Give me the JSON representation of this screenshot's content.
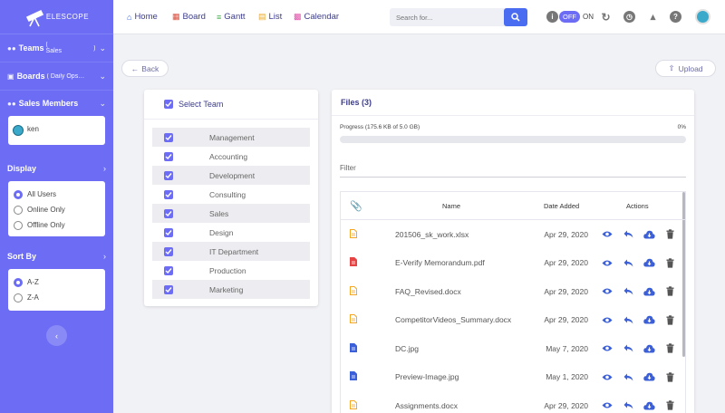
{
  "app": {
    "logo_text": "ELESCOPE"
  },
  "sidebar": {
    "teams_label": "Teams",
    "teams_value": "( Sales",
    "teams_close": ")",
    "boards_label": "Boards",
    "boards_value": "( Daily Ops…",
    "members_label": "Sales Members",
    "member_name": "ken",
    "display_label": "Display",
    "display_options": [
      "All Users",
      "Online Only",
      "Offline Only"
    ],
    "display_selected": "All Users",
    "sortby_label": "Sort By",
    "sort_options": [
      "A-Z",
      "Z-A"
    ],
    "sort_selected": "A-Z"
  },
  "nav": {
    "home": "Home",
    "board": "Board",
    "gantt": "Gantt",
    "list": "List",
    "calendar": "Calendar"
  },
  "search": {
    "placeholder": "Search for..."
  },
  "toggle": {
    "off": "OFF",
    "on": "ON"
  },
  "actions": {
    "back": "Back",
    "upload": "Upload"
  },
  "team_panel": {
    "title": "Select Team",
    "teams": [
      "Management",
      "Accounting",
      "Development",
      "Consulting",
      "Sales",
      "Design",
      "IT Department",
      "Production",
      "Marketing"
    ]
  },
  "files_panel": {
    "title": "Files (3)",
    "progress_label": "Progress (175.6 KB of 5.0 GB)",
    "progress_percent": "0%",
    "progress_fraction": 0.0,
    "filter_placeholder": "Filter",
    "columns": {
      "name": "Name",
      "date": "Date Added",
      "actions": "Actions"
    },
    "files": [
      {
        "name": "201506_sk_work.xlsx",
        "date": "Apr 29, 2020",
        "type": "doc"
      },
      {
        "name": "E-Verify Memorandum.pdf",
        "date": "Apr 29, 2020",
        "type": "pdf"
      },
      {
        "name": "FAQ_Revised.docx",
        "date": "Apr 29, 2020",
        "type": "doc"
      },
      {
        "name": "CompetitorVideos_Summary.docx",
        "date": "Apr 29, 2020",
        "type": "doc"
      },
      {
        "name": "DC.jpg",
        "date": "May 7, 2020",
        "type": "image"
      },
      {
        "name": "Preview-Image.jpg",
        "date": "May 1, 2020",
        "type": "image"
      },
      {
        "name": "Assignments.docx",
        "date": "Apr 29, 2020",
        "type": "doc"
      }
    ]
  },
  "colors": {
    "accent": "#6c6cf5",
    "pdf": "#e64444",
    "doc": "#f5a623",
    "image": "#3b5fd9",
    "action": "#3b5fd9"
  }
}
